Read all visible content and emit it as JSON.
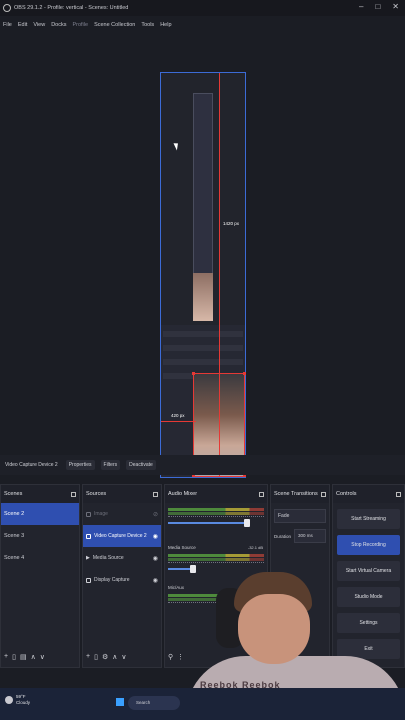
{
  "window": {
    "title": "OBS 29.1.2 - Profile: vertical - Scenes: Untitled",
    "buttons": [
      "–",
      "□",
      "✕"
    ]
  },
  "menu": [
    "File",
    "Edit",
    "View",
    "Docks",
    "Profile",
    "Scene Collection",
    "Tools",
    "Help"
  ],
  "preview": {
    "measure_vertical": "1420 px",
    "measure_horizontal": "420 px"
  },
  "source_toolbar": {
    "source_name": "Video Capture Device 2",
    "properties": "Properties",
    "filters": "Filters",
    "deactivate": "Deactivate"
  },
  "scenes": {
    "title": "Scenes",
    "items": [
      "Scene 2",
      "Scene 3",
      "Scene 4"
    ],
    "selected": "Scene 2"
  },
  "sources": {
    "title": "Sources",
    "items": [
      "Image",
      "Video Capture Device 2",
      "Media Source",
      "Display Capture"
    ],
    "selected": "Video Capture Device 2"
  },
  "mixer": {
    "title": "Audio Mixer",
    "channels": [
      {
        "name": "",
        "db": ""
      },
      {
        "name": "Media Source",
        "db": "-32.1 dB"
      },
      {
        "name": "Mic/Aux",
        "db": ""
      }
    ]
  },
  "transitions": {
    "title": "Scene Transitions",
    "selected": "Fade",
    "duration_label": "Duration",
    "duration_value": "300 ms"
  },
  "controls": {
    "title": "Controls",
    "buttons": [
      "Start Streaming",
      "Stop Recording",
      "Start Virtual Camera",
      "Studio Mode",
      "Settings",
      "Exit"
    ]
  },
  "taskbar": {
    "temperature": "59°F",
    "weather": "Cloudy",
    "search": "Search"
  },
  "webcam": {
    "shirt_text": "Reebok  Reebok"
  }
}
